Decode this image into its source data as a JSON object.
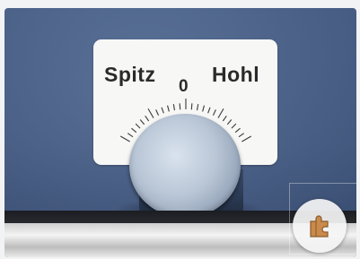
{
  "dial_plate": {
    "left_label": "Spitz",
    "center_mark": "0",
    "right_label": "Hohl"
  },
  "colors": {
    "panel": "#4a628c",
    "plate": "#f7f7f5",
    "knob": "#b9c6d6",
    "zoom_icon": "#c98a4b"
  },
  "overlay": {
    "zoom_icon": "puzzle-piece-icon"
  }
}
